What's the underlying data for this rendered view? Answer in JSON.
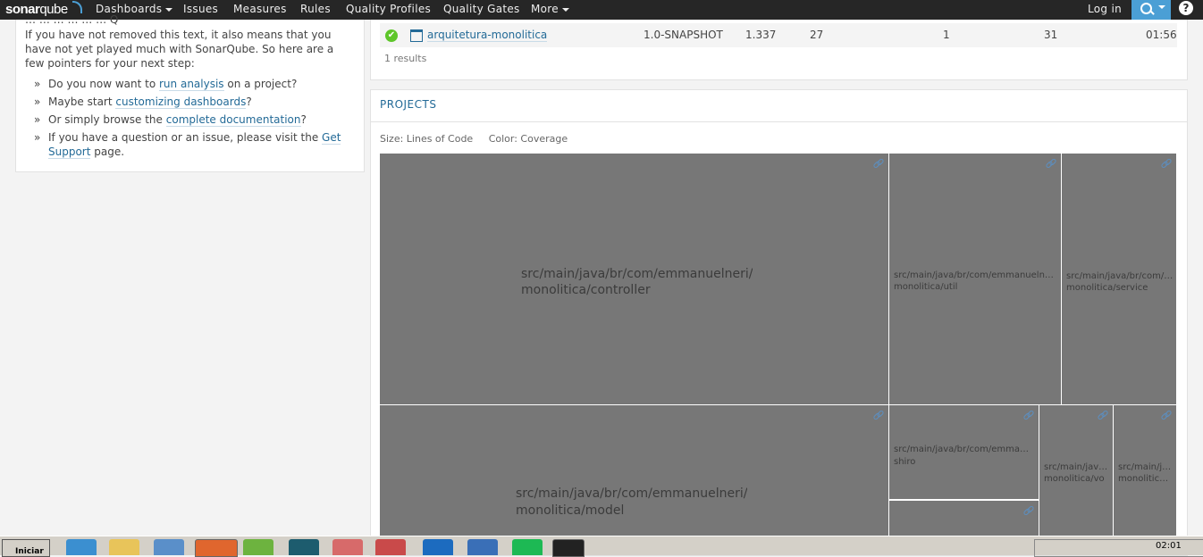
{
  "nav": {
    "logo_sonar": "sonar",
    "logo_qube": "qube",
    "items": [
      {
        "label": "Dashboards",
        "dropdown": true
      },
      {
        "label": "Issues",
        "dropdown": false
      },
      {
        "label": "Measures",
        "dropdown": false
      },
      {
        "label": "Rules",
        "dropdown": false
      },
      {
        "label": "Quality Profiles",
        "dropdown": false
      },
      {
        "label": "Quality Gates",
        "dropdown": false
      },
      {
        "label": "More",
        "dropdown": true
      }
    ],
    "login": "Log in",
    "search_icon": "search-icon",
    "help_icon": "help-icon",
    "help_glyph": "?"
  },
  "welcome": {
    "cut_line": "…  … … … … … Q",
    "intro": "If you have not removed this text, it also means that you have not yet played much with SonarQube. So here are a few pointers for your next step:",
    "bullet": "»",
    "pointers": [
      {
        "before": "Do you now want to ",
        "link": "run analysis",
        "after": " on a project?"
      },
      {
        "before": "Maybe start ",
        "link": "customizing dashboards",
        "after": "?"
      },
      {
        "before": "Or simply browse the ",
        "link": "complete documentation",
        "after": "?"
      },
      {
        "before": "If you have a question or an issue, please visit the ",
        "link": "Get Support",
        "after": " page."
      }
    ]
  },
  "results": {
    "row": {
      "name": "arquitetura-monolitica",
      "version": "1.0-SNAPSHOT",
      "lines": "1.337",
      "col3": "27",
      "col4": "1",
      "col5": "31",
      "time": "01:56",
      "quality_gate_color": "#5ec62a",
      "check_glyph": "✔"
    },
    "count": "1 results"
  },
  "projects": {
    "title": "PROJECTS",
    "size_label": "Size: Lines of Code",
    "color_label": "Color: Coverage",
    "cells": [
      {
        "line1": "src/main/java/br/com/emmanuelneri/",
        "line2": "monolitica/controller"
      },
      {
        "line1": "src/main/java/br/com/emmanuelneri/",
        "line2": "monolitica/util"
      },
      {
        "line1": "src/main/java/br/com/emmanuelneri/",
        "line2": "monolitica/service"
      },
      {
        "line1": "src/main/java/br/com/emmanuelneri/",
        "line2": "monolitica/model"
      },
      {
        "line1": "src/main/java/br/com/emmanuelneri/",
        "line2": "shiro"
      },
      {
        "line1": "src/main/java/br/com/emmanuelneri/",
        "line2": "monolitica/vo"
      },
      {
        "line1": "src/main/java/br/com/emmanuelneri/",
        "line2": "monolitica/..."
      },
      {
        "line1": "",
        "line2": ""
      }
    ],
    "cell_color": "#777777"
  },
  "taskbar": {
    "start": "Iniciar",
    "clock": "02:01"
  }
}
